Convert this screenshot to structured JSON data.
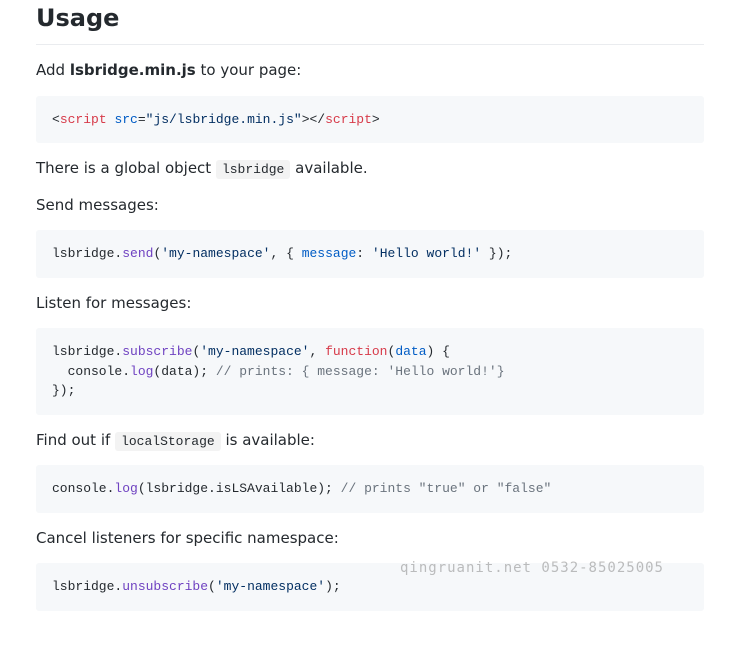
{
  "heading": "Usage",
  "p1_prefix": "Add ",
  "p1_strong": "lsbridge.min.js",
  "p1_suffix": " to your page:",
  "code1": {
    "t1": "<",
    "t2": "script",
    "t3": " ",
    "t4": "src",
    "t5": "=",
    "t6": "\"js/lsbridge.min.js\"",
    "t7": "></",
    "t8": "script",
    "t9": ">"
  },
  "p2_prefix": "There is a global object ",
  "p2_code": "lsbridge",
  "p2_suffix": " available.",
  "p3": "Send messages:",
  "code2": {
    "a": "lsbridge.",
    "b": "send",
    "c": "(",
    "d": "'my-namespace'",
    "e": ", { ",
    "f": "message",
    "g": ": ",
    "h": "'Hello world!'",
    "i": " });"
  },
  "p4": "Listen for messages:",
  "code3": {
    "l1a": "lsbridge.",
    "l1b": "subscribe",
    "l1c": "(",
    "l1d": "'my-namespace'",
    "l1e": ", ",
    "l1f": "function",
    "l1g": "(",
    "l1h": "data",
    "l1i": ") {",
    "l2a": "  console.",
    "l2b": "log",
    "l2c": "(data); ",
    "l2d": "// prints: { message: 'Hello world!'}",
    "l3": "});"
  },
  "p5_prefix": "Find out if ",
  "p5_code": "localStorage",
  "p5_suffix": " is available:",
  "code4": {
    "a": "console.",
    "b": "log",
    "c": "(lsbridge.isLSAvailable); ",
    "d": "// prints \"true\" or \"false\""
  },
  "p6": "Cancel listeners for specific namespace:",
  "code5": {
    "a": "lsbridge.",
    "b": "unsubscribe",
    "c": "(",
    "d": "'my-namespace'",
    "e": ");"
  },
  "watermark": "qingruanit.net 0532-85025005"
}
